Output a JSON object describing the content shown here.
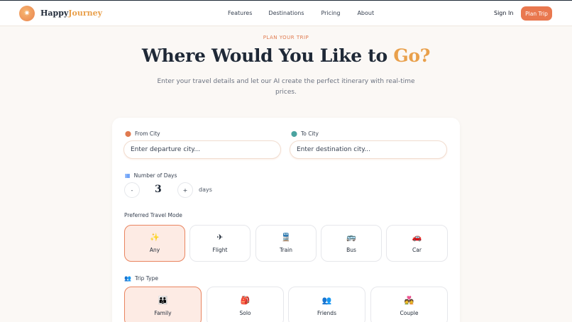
{
  "brand": {
    "name_part1": "Happy",
    "name_part2": "Journey"
  },
  "nav": {
    "features": "Features",
    "destinations": "Destinations",
    "pricing": "Pricing",
    "about": "About"
  },
  "header_actions": {
    "sign_in": "Sign In",
    "plan_trip": "Plan Trip"
  },
  "hero": {
    "eyebrow": "PLAN YOUR TRIP",
    "title_main": "Where Would You Like to ",
    "title_accent": "Go?",
    "subtitle": "Enter your travel details and let our AI create the perfect itinerary with real-time prices."
  },
  "form": {
    "from": {
      "label": "From City",
      "placeholder": "Enter departure city..."
    },
    "to": {
      "label": "To City",
      "placeholder": "Enter destination city..."
    },
    "days": {
      "label": "Number of Days",
      "value": "3",
      "minus": "-",
      "plus": "+",
      "unit": "days"
    },
    "travel_mode": {
      "label": "Preferred Travel Mode",
      "options": [
        {
          "label": "Any",
          "icon": "sparkles-icon",
          "selected": true
        },
        {
          "label": "Flight",
          "icon": "plane-icon",
          "selected": false
        },
        {
          "label": "Train",
          "icon": "train-icon",
          "selected": false
        },
        {
          "label": "Bus",
          "icon": "bus-icon",
          "selected": false
        },
        {
          "label": "Car",
          "icon": "car-icon",
          "selected": false
        }
      ]
    },
    "trip_type": {
      "label": "Trip Type",
      "options": [
        {
          "label": "Family",
          "icon": "family-icon",
          "selected": true
        },
        {
          "label": "Solo",
          "icon": "backpack-icon",
          "selected": false
        },
        {
          "label": "Friends",
          "icon": "friends-icon",
          "selected": false
        },
        {
          "label": "Couple",
          "icon": "couple-icon",
          "selected": false
        }
      ]
    }
  },
  "colors": {
    "accent": "#e9784f",
    "gold": "#e9a04b",
    "selected_bg": "#fdebe4",
    "background": "#fbf8f5"
  }
}
